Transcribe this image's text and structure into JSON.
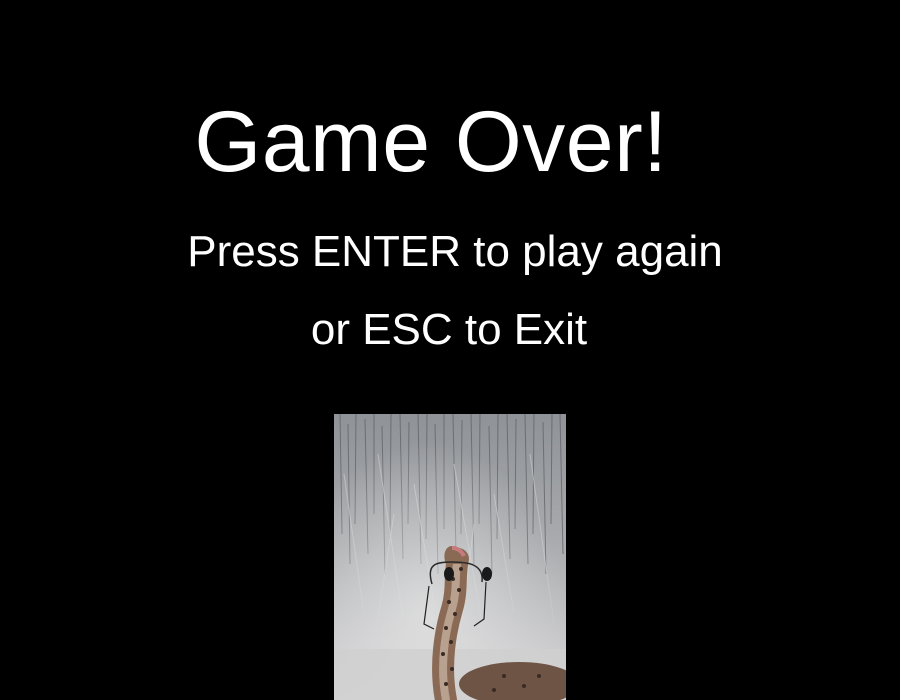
{
  "screen": {
    "title": "Game Over!",
    "prompt_line1": "Press ENTER to play again",
    "prompt_line2": "or ESC to Exit"
  },
  "image": {
    "subject": "snake-wearing-headphones-in-rain",
    "icon": "snake-photo"
  },
  "colors": {
    "background": "#000000",
    "text": "#ffffff",
    "photo_bg": "#b9babc",
    "snake_body": "#8a6a55"
  }
}
